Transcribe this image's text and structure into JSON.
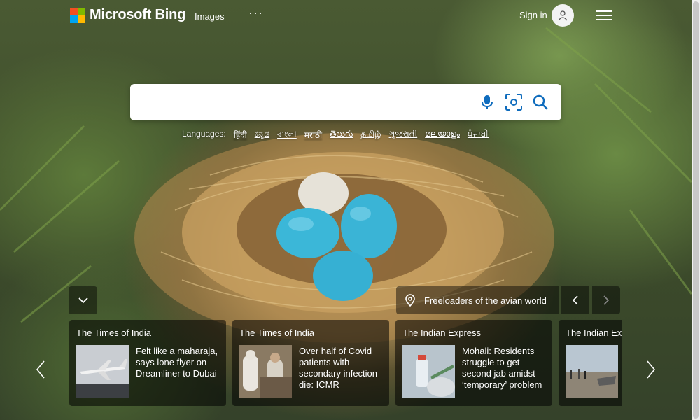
{
  "header": {
    "logo_text": "Microsoft Bing",
    "nav_images": "Images",
    "nav_more": "···",
    "signin_label": "Sign in"
  },
  "search": {
    "value": "",
    "placeholder": ""
  },
  "languages": {
    "label": "Languages:",
    "items": [
      "हिंदी",
      "ಕನ್ನಡ",
      "বাংলা",
      "मराठी",
      "తెలుగు",
      "தமிழ்",
      "ગુજરાતી",
      "മലയാളം",
      "ਪੰਜਾਬੀ"
    ]
  },
  "image_caption": "Freeloaders of the avian world",
  "news": [
    {
      "source": "The Times of India",
      "headline": "Felt like a maharaja, says lone flyer on Dreamliner to Dubai",
      "thumb": "airplane"
    },
    {
      "source": "The Times of India",
      "headline": "Over half of Covid patients with secondary infection die: ICMR",
      "thumb": "hospital"
    },
    {
      "source": "The Indian Express",
      "headline": "Mohali: Residents struggle to get second jab amidst ‘temporary’ problem",
      "thumb": "vaccine"
    },
    {
      "source": "The Indian Express",
      "headline": "",
      "thumb": "beach"
    }
  ],
  "colors": {
    "logo_red": "#f25022",
    "logo_green": "#7fba00",
    "logo_blue": "#00a4ef",
    "logo_yellow": "#ffb900",
    "search_icon": "#0f6cbd",
    "egg_blue": "#38b6d8"
  },
  "icons": {
    "mic": "microphone-icon",
    "visual_search": "visual-search-icon",
    "search": "search-icon",
    "location": "location-pin-icon"
  }
}
